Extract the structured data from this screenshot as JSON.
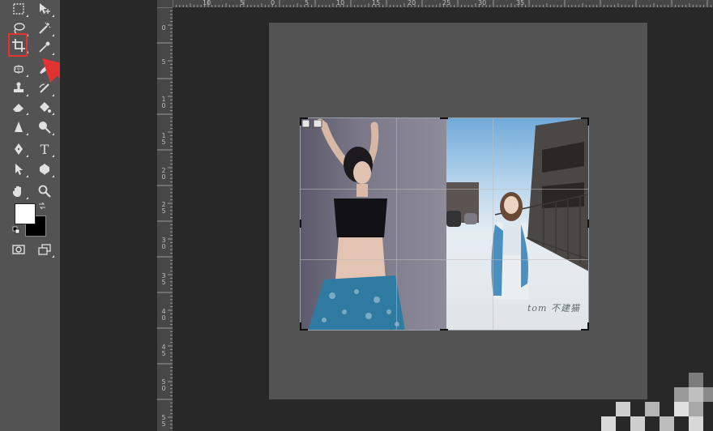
{
  "tools": [
    {
      "name": "marquee-tool-icon"
    },
    {
      "name": "move-tool-icon"
    },
    {
      "name": "lasso-tool-icon"
    },
    {
      "name": "magic-wand-tool-icon"
    },
    {
      "name": "crop-tool-icon",
      "selected": true
    },
    {
      "name": "eyedropper-tool-icon"
    },
    {
      "name": "spot-healing-brush-tool-icon"
    },
    {
      "name": "brush-tool-icon"
    },
    {
      "name": "clone-stamp-tool-icon"
    },
    {
      "name": "history-brush-tool-icon"
    },
    {
      "name": "eraser-tool-icon"
    },
    {
      "name": "paint-bucket-tool-icon"
    },
    {
      "name": "blur-tool-icon"
    },
    {
      "name": "dodge-tool-icon"
    },
    {
      "name": "pen-tool-icon"
    },
    {
      "name": "type-tool-icon",
      "glyph": "T"
    },
    {
      "name": "path-selection-tool-icon"
    },
    {
      "name": "custom-shape-tool-icon"
    },
    {
      "name": "hand-tool-icon"
    },
    {
      "name": "zoom-tool-icon"
    },
    {
      "name": "quick-mask-icon"
    },
    {
      "name": "screen-mode-icon"
    }
  ],
  "colors": {
    "foreground": "#ffffff",
    "background": "#000000",
    "highlight": "#e23333",
    "arrow": "#e23333"
  },
  "ruler_top_labels": [
    "10",
    "5",
    "0",
    "5",
    "10",
    "15",
    "20",
    "25",
    "30",
    "35"
  ],
  "ruler_left_labels": [
    "0",
    "5",
    "1\n0",
    "1\n5",
    "2\n0",
    "2\n5",
    "3\n0",
    "3\n5",
    "4\n0",
    "4\n5",
    "5\n0",
    "5\n5"
  ],
  "watermark": "tom 不建猫"
}
